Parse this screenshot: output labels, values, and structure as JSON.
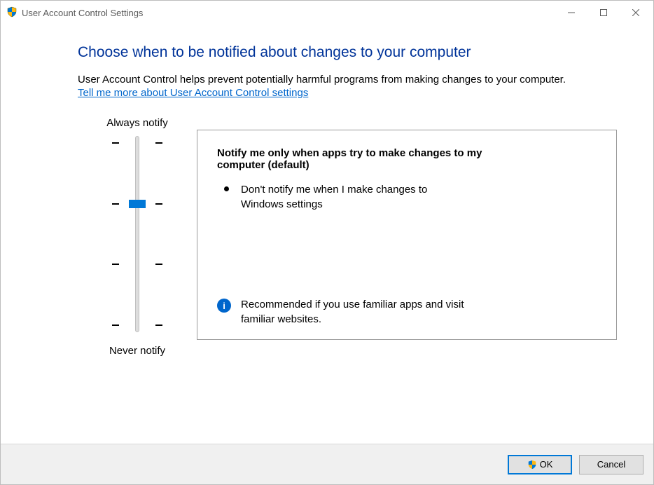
{
  "window": {
    "title": "User Account Control Settings"
  },
  "main": {
    "heading": "Choose when to be notified about changes to your computer",
    "description": "User Account Control helps prevent potentially harmful programs from making changes to your computer.",
    "learn_more": "Tell me more about User Account Control settings"
  },
  "slider": {
    "top_label": "Always notify",
    "bottom_label": "Never notify",
    "levels": 4,
    "selected_index": 1
  },
  "panel": {
    "title": "Notify me only when apps try to make changes to my computer (default)",
    "bullets": [
      "Don't notify me when I make changes to Windows settings"
    ],
    "recommendation": "Recommended if you use familiar apps and visit familiar websites."
  },
  "footer": {
    "ok_label": "OK",
    "cancel_label": "Cancel"
  }
}
